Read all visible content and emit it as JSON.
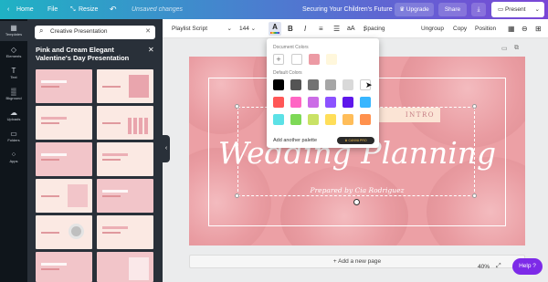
{
  "topbar": {
    "home": "Home",
    "file": "File",
    "resize": "Resize",
    "undo_icon": "undo-icon",
    "status": "Unsaved changes",
    "doc_title": "Securing Your Children's Future",
    "upgrade": "Upgrade",
    "share": "Share",
    "download_icon": "download-icon",
    "present": "Present",
    "accent": "#7a46d6"
  },
  "rail": [
    {
      "icon": "templates-icon",
      "label": "Templates"
    },
    {
      "icon": "elements-icon",
      "label": "Elements"
    },
    {
      "icon": "text-icon",
      "label": "Text"
    },
    {
      "icon": "background-icon",
      "label": "Bkground"
    },
    {
      "icon": "uploads-icon",
      "label": "Uploads"
    },
    {
      "icon": "folders-icon",
      "label": "Folders"
    },
    {
      "icon": "apps-icon",
      "label": "Apps"
    }
  ],
  "panel": {
    "search_value": "Creative Presentation",
    "title": "Pink and Cream Elegant Valentine's Day Presentation"
  },
  "toolbar": {
    "font": "Playlist Script",
    "size": "144",
    "ungroup": "Ungroup",
    "spacing": "Spacing",
    "copy": "Copy",
    "position": "Position"
  },
  "color_menu": {
    "document_colors": "Document Colors",
    "default_colors": "Default Colors",
    "add_palette": "Add another palette",
    "badge": "CANVA PRO",
    "doc_swatches": [
      "#ffffff",
      "#ec9aa4",
      "#fff7dc"
    ],
    "default_swatches": [
      "#000000",
      "#545454",
      "#737373",
      "#a6a6a6",
      "#d9d9d9",
      "#ffffff",
      "#ff5757",
      "#ff66c4",
      "#cb6ce6",
      "#8c52ff",
      "#5e17eb",
      "#38b6ff",
      "#5ce1e6",
      "#7ed957",
      "#c9e265",
      "#ffde59",
      "#ffbd59",
      "#ff914d"
    ]
  },
  "slide": {
    "subtitle": "INTRO",
    "headline": "Wedding Planning",
    "byline": "Prepared by Cia Rodriguez",
    "bg": "#eca0a5"
  },
  "bottom": {
    "add_page": "+ Add a new page",
    "zoom": "40%",
    "help": "Help ?"
  }
}
